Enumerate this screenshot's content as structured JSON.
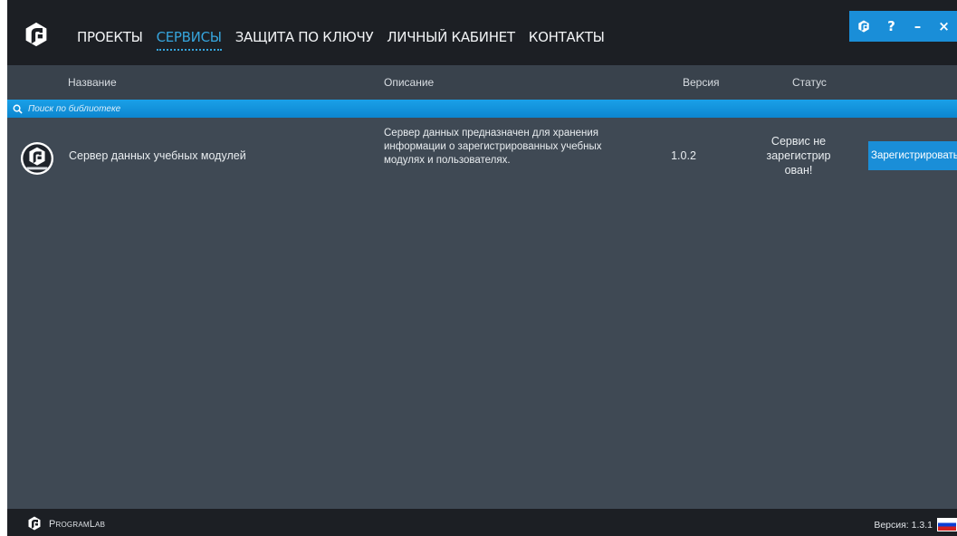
{
  "nav": {
    "items": [
      {
        "label": "ПРОЕКТЫ",
        "active": false
      },
      {
        "label": "СЕРВИСЫ",
        "active": true
      },
      {
        "label": "ЗАЩИТА ПО КЛЮЧУ",
        "active": false
      },
      {
        "label": "ЛИЧНЫЙ КАБИНЕТ",
        "active": false
      },
      {
        "label": "КОНТАКТЫ",
        "active": false
      }
    ]
  },
  "window_controls": {
    "icons": [
      "programlab-logo-icon",
      "help-icon",
      "minimize-icon",
      "close-icon"
    ],
    "help_label": "?",
    "minimize_label": "–",
    "close_label": "×"
  },
  "table": {
    "columns": {
      "name": "Название",
      "description": "Описание",
      "version": "Версия",
      "status": "Статус"
    },
    "rows": [
      {
        "icon": "programlab-module-icon",
        "name": "Сервер данных учебных модулей",
        "description": "Сервер данных предназначен для хранения информации о зарегистрированных учебных модулях и пользователях.",
        "version": "1.0.2",
        "status": "Сервис не зарегистрир ован!",
        "action_label": "Зарегистрировать"
      }
    ]
  },
  "search": {
    "placeholder": "Поиск по библиотеке",
    "value": ""
  },
  "footer": {
    "brand": "ProgramLab",
    "version": "Версия: 1.3.1",
    "flag": "russia-flag-icon"
  },
  "colors": {
    "accent": "#1a8ed8",
    "nav_active": "#36a4dc",
    "bar_dark": "#1c1f24",
    "content_bg": "#3f4954",
    "header_bg": "#39424c"
  }
}
